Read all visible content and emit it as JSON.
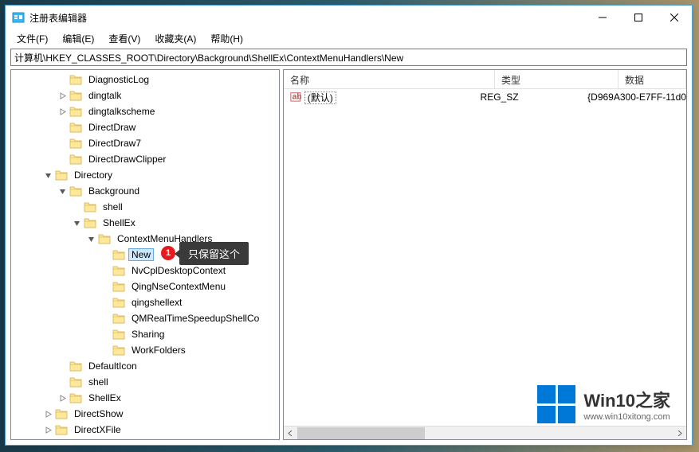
{
  "window": {
    "title": "注册表编辑器"
  },
  "menu": {
    "file": "文件(F)",
    "edit": "编辑(E)",
    "view": "查看(V)",
    "favorites": "收藏夹(A)",
    "help": "帮助(H)"
  },
  "address": "计算机\\HKEY_CLASSES_ROOT\\Directory\\Background\\ShellEx\\ContextMenuHandlers\\New",
  "tree": [
    {
      "indent": 3,
      "exp": "none",
      "label": "DiagnosticLog"
    },
    {
      "indent": 3,
      "exp": "closed",
      "label": "dingtalk"
    },
    {
      "indent": 3,
      "exp": "closed",
      "label": "dingtalkscheme"
    },
    {
      "indent": 3,
      "exp": "none",
      "label": "DirectDraw"
    },
    {
      "indent": 3,
      "exp": "none",
      "label": "DirectDraw7"
    },
    {
      "indent": 3,
      "exp": "none",
      "label": "DirectDrawClipper"
    },
    {
      "indent": 2,
      "exp": "open",
      "label": "Directory"
    },
    {
      "indent": 3,
      "exp": "open",
      "label": "Background"
    },
    {
      "indent": 4,
      "exp": "none",
      "label": "shell"
    },
    {
      "indent": 4,
      "exp": "open",
      "label": "ShellEx"
    },
    {
      "indent": 5,
      "exp": "open",
      "label": "ContextMenuHandlers"
    },
    {
      "indent": 6,
      "exp": "none",
      "label": "New",
      "selected": true
    },
    {
      "indent": 6,
      "exp": "none",
      "label": "NvCplDesktopContext"
    },
    {
      "indent": 6,
      "exp": "none",
      "label": "QingNseContextMenu"
    },
    {
      "indent": 6,
      "exp": "none",
      "label": "qingshellext"
    },
    {
      "indent": 6,
      "exp": "none",
      "label": "QMRealTimeSpeedupShellCo"
    },
    {
      "indent": 6,
      "exp": "none",
      "label": "Sharing"
    },
    {
      "indent": 6,
      "exp": "none",
      "label": "WorkFolders"
    },
    {
      "indent": 3,
      "exp": "none",
      "label": "DefaultIcon"
    },
    {
      "indent": 3,
      "exp": "none",
      "label": "shell"
    },
    {
      "indent": 3,
      "exp": "closed",
      "label": "ShellEx"
    },
    {
      "indent": 2,
      "exp": "closed",
      "label": "DirectShow"
    },
    {
      "indent": 2,
      "exp": "closed",
      "label": "DirectXFile"
    }
  ],
  "list": {
    "headers": {
      "name": "名称",
      "type": "类型",
      "data": "数据"
    },
    "rows": [
      {
        "name": "(默认)",
        "type": "REG_SZ",
        "data": "{D969A300-E7FF-11d0"
      }
    ]
  },
  "annotation": {
    "number": "1",
    "text": "只保留这个"
  },
  "watermark": {
    "brand": "Win10之家",
    "url": "www.win10xitong.com"
  }
}
